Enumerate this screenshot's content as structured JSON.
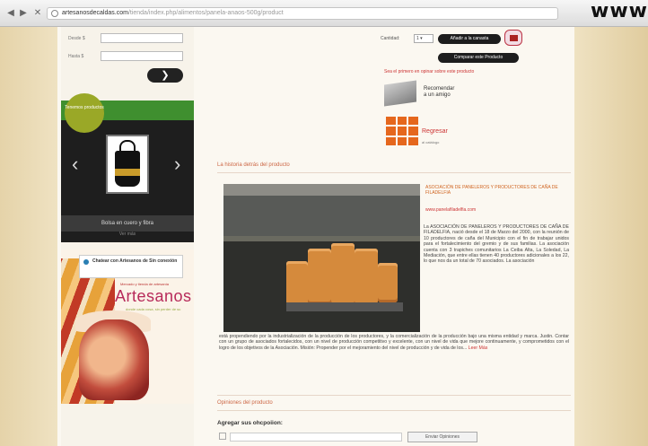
{
  "browser": {
    "back": "◀",
    "forward": "▶",
    "stop": "✕",
    "url_host": "artesanosdecaldas.com",
    "url_path": "/tienda/index.php/alimentos/panela-anaos-500g/product",
    "watermark": "www"
  },
  "sidebar": {
    "from_label": "Desde $",
    "to_label": "Hasta $",
    "go_icon": "arrow-right-icon",
    "go_label": "❯",
    "promo_badge": "Tenemos productos",
    "promo_prev": "‹",
    "promo_next": "›",
    "promo_caption": "Bolsa en cuero y fibra",
    "promo_more": "Ver más",
    "chat_text": "Chatear con Artesanos de Sin conexión",
    "art_sub": "Mercado y tienda de artesanía",
    "art_title": "Artesanos",
    "art_note": "donde cada cosa, sin perder de su sabor"
  },
  "product": {
    "qty_label": "Cantidad:",
    "qty_value": "1 ▾",
    "add_to_cart": "Añadir a la canasta",
    "compare": "Comparar este Producto",
    "notify": "Sea el primero en opinar sobre este producto",
    "recommend_line1": "Recomendar",
    "recommend_line2": "a un amigo",
    "return_line1": "Regresar",
    "return_line2": "al catálogo"
  },
  "article": {
    "section_title": "La historia detrás del producto",
    "title": "ASOCIACIÓN DE PANELEROS Y PRODUCTORES DE CAÑA DE FILADELFIA",
    "url": "www.panelafiladelfia.com",
    "body_column": "La ASOCIACIÓN DE PANELEROS Y PRODUCTORES DE CAÑA DE FILADELFIA, nació desde el 18 de Marzo del 2000, con la reunión de 10 productores de caña del Municipio con el fin de trabajar unidos para el fortalecimiento del gremio y de sus familias. La asociación cuenta con 3 trapiches comunitarios La Ceiba Alta, La Soledad, La Mediación, que entre ellas tienen 40 productores adicionales a los 22, lo que nos da un total de 70 asociados. La asociación",
    "body_full": "está propendiendo por la industrialización de la producción de los productores, y la comercialización de la producción bajo una misma entidad y marca. Justin. Contar con un grupo de asociados fortalecidos, con un nivel de producción competitivo y excelente, con un nivel de vida que mejore continuamente, y comprometidos con el logro de los objetivos de la Asociación. Misión: Propender por el mejoramiento del nivel de producción y de vida de los...",
    "read_more": "Leer Más"
  },
  "opinions": {
    "section_title": "Opiniones del producto",
    "add_title": "Agregar sus ohcpoiion:",
    "submit": "Enviar Opiniones"
  },
  "colors": {
    "accent": "#c64420",
    "promo_green": "#3f8f2f",
    "grid_orange": "#e5671d"
  }
}
